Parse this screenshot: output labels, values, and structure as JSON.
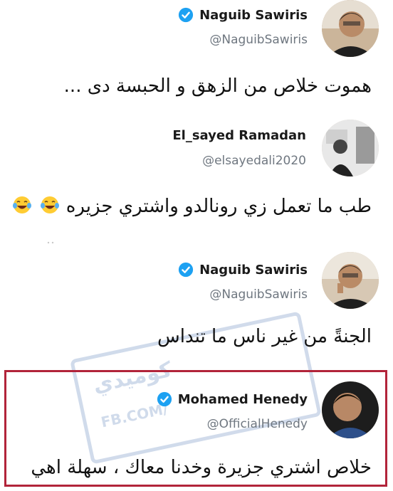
{
  "tweets": [
    {
      "name": "Naguib Sawiris",
      "verified": true,
      "handle": "@NaguibSawiris",
      "text": "هموت خلاص من الزهق و الحبسة دى ..."
    },
    {
      "name": "El_sayed Ramadan",
      "verified": false,
      "handle": "@elsayedali2020",
      "text": "طب ما تعمل زي رونالدو واشتري جزيره",
      "emoji": "😂😂"
    },
    {
      "name": "Naguib Sawiris",
      "verified": true,
      "handle": "@NaguibSawiris",
      "text": "الجنةً من غير ناس ما تنداس"
    },
    {
      "name": "Mohamed Henedy",
      "verified": true,
      "handle": "@OfficialHenedy",
      "text": "خلاص اشتري جزيرة وخدنا معاك ، سهلة اهي"
    }
  ],
  "watermark": {
    "line1": "كوميدي",
    "line2": "FB.COM/"
  },
  "colors": {
    "verified_blue": "#1da1f2",
    "highlight_border": "#b2243a",
    "watermark_blue": "#5a7fb8"
  },
  "icons": {
    "verified": "verified-badge-icon",
    "emoji": "tears-of-joy-emoji-icon"
  }
}
